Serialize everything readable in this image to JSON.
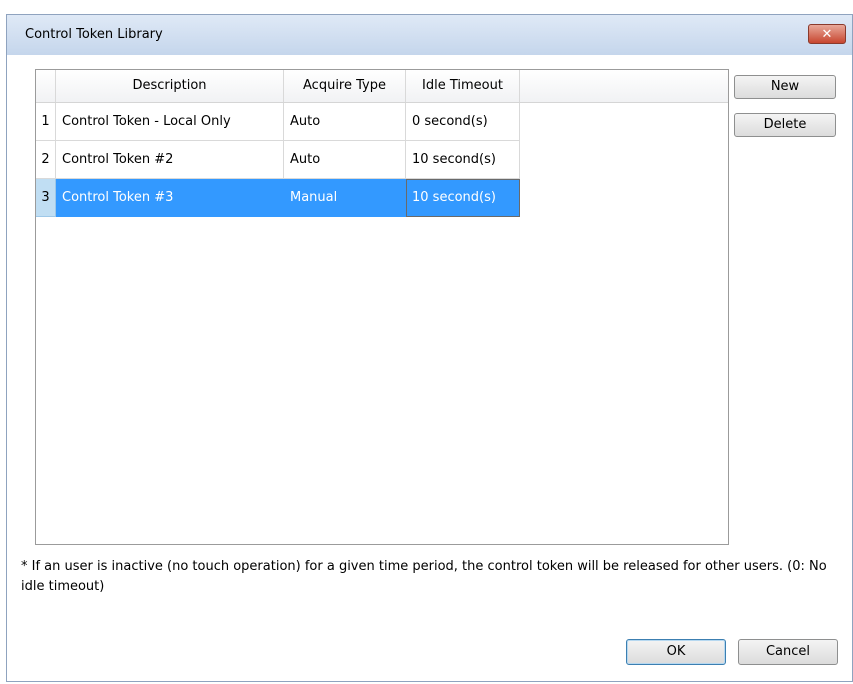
{
  "window": {
    "title": "Control Token Library",
    "close_symbol": "✕"
  },
  "grid": {
    "columns": [
      "",
      "Description",
      "Acquire Type",
      "Idle Timeout"
    ],
    "rows": [
      {
        "num": "1",
        "description": "Control Token - Local Only",
        "acquire_type": "Auto",
        "idle_timeout": "0 second(s)"
      },
      {
        "num": "2",
        "description": "Control Token #2",
        "acquire_type": "Auto",
        "idle_timeout": "10 second(s)"
      },
      {
        "num": "3",
        "description": "Control Token #3",
        "acquire_type": "Manual",
        "idle_timeout": "10 second(s)"
      }
    ],
    "selected_row": 3
  },
  "buttons": {
    "new": "New",
    "delete": "Delete",
    "ok": "OK",
    "cancel": "Cancel"
  },
  "note": "* If an user is inactive (no touch operation) for a given time period, the control token will be released for other users. (0: No idle timeout)",
  "colors": {
    "selection": "#3399ff",
    "titlebar": "#c5d6ec",
    "close_button": "#c7462f"
  }
}
